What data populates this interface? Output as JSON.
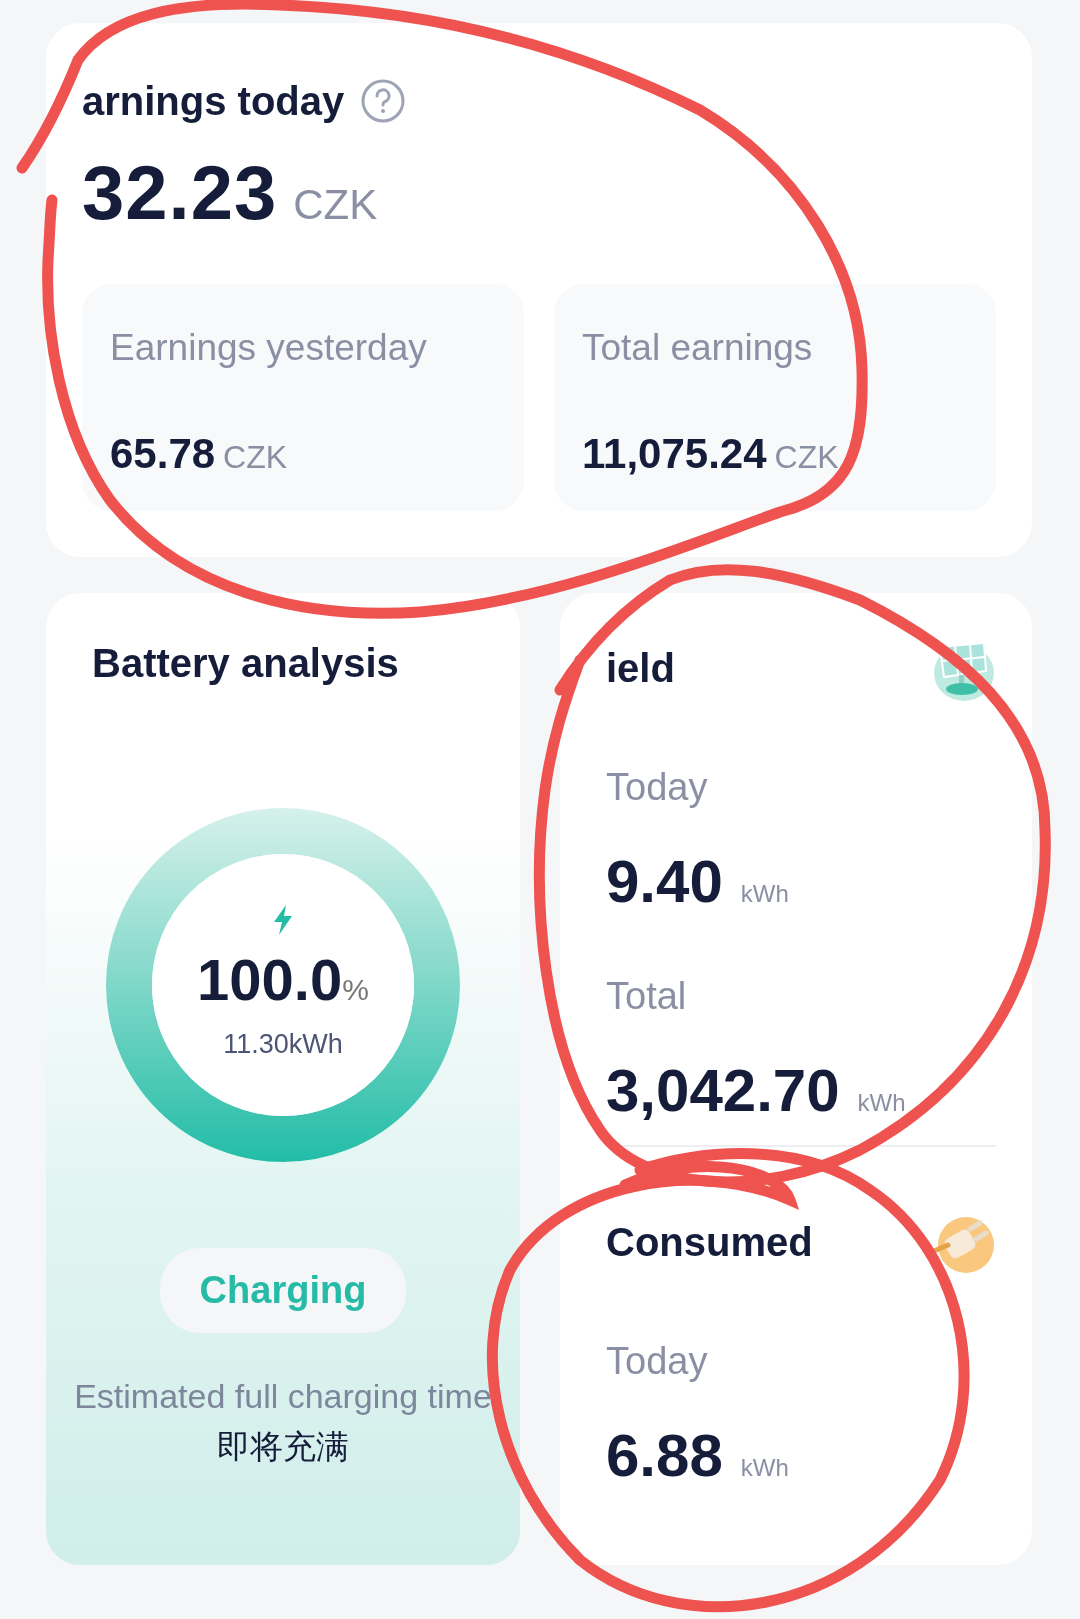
{
  "earnings_today": {
    "title": "arnings today",
    "value": "32.23",
    "unit": "CZK"
  },
  "earnings_stats": [
    {
      "label": "Earnings yesterday",
      "value": "65.78",
      "unit": "CZK"
    },
    {
      "label": "Total earnings",
      "value": "11,075.24",
      "unit": "CZK"
    }
  ],
  "battery": {
    "title": "Battery analysis",
    "level": 1.0,
    "percent": "100.0",
    "percent_unit": "%",
    "energy": "11.30kWh",
    "status": "Charging",
    "estimate_label": "Estimated full charging time",
    "estimate_value": "即将充满"
  },
  "energy_cards": [
    {
      "kind": "yield",
      "title": "ield",
      "rows": [
        {
          "label": "Today",
          "value": "9.40",
          "unit": "kWh"
        },
        {
          "label": "Total",
          "value": "3,042.70",
          "unit": "kWh"
        }
      ]
    },
    {
      "kind": "consumed",
      "title": "Consumed",
      "rows": [
        {
          "label": "Today",
          "value": "6.88",
          "unit": "kWh"
        }
      ]
    }
  ]
}
